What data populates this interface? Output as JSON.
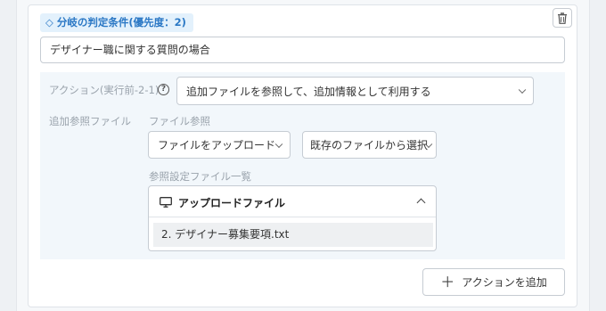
{
  "condition": {
    "tag_label": "◇ 分岐の判定条件(優先度：2)",
    "input_value": "デザイナー職に関する質問の場合"
  },
  "action": {
    "label": "アクション(実行前-2-1)",
    "help_glyph": "?",
    "select_value": "追加ファイルを参照して、追加情報として利用する"
  },
  "reference": {
    "label": "追加参照ファイル",
    "file_ref_label": "ファイル参照",
    "upload_dropdown": "ファイルをアップロード",
    "existing_dropdown": "既存のファイルから選択",
    "list_label": "参照設定ファイル一覧",
    "upload_panel_title": "アップロードファイル",
    "files": [
      "2. デザイナー募集要項.txt"
    ]
  },
  "add_action_button": "アクションを追加",
  "icons": {
    "trash": "trash-icon",
    "monitor": "monitor-icon",
    "plus": "plus-icon"
  },
  "colors": {
    "tag_bg": "#e3f1fc",
    "tag_text": "#2b78c5",
    "action_area_bg": "#f2f7fb"
  }
}
